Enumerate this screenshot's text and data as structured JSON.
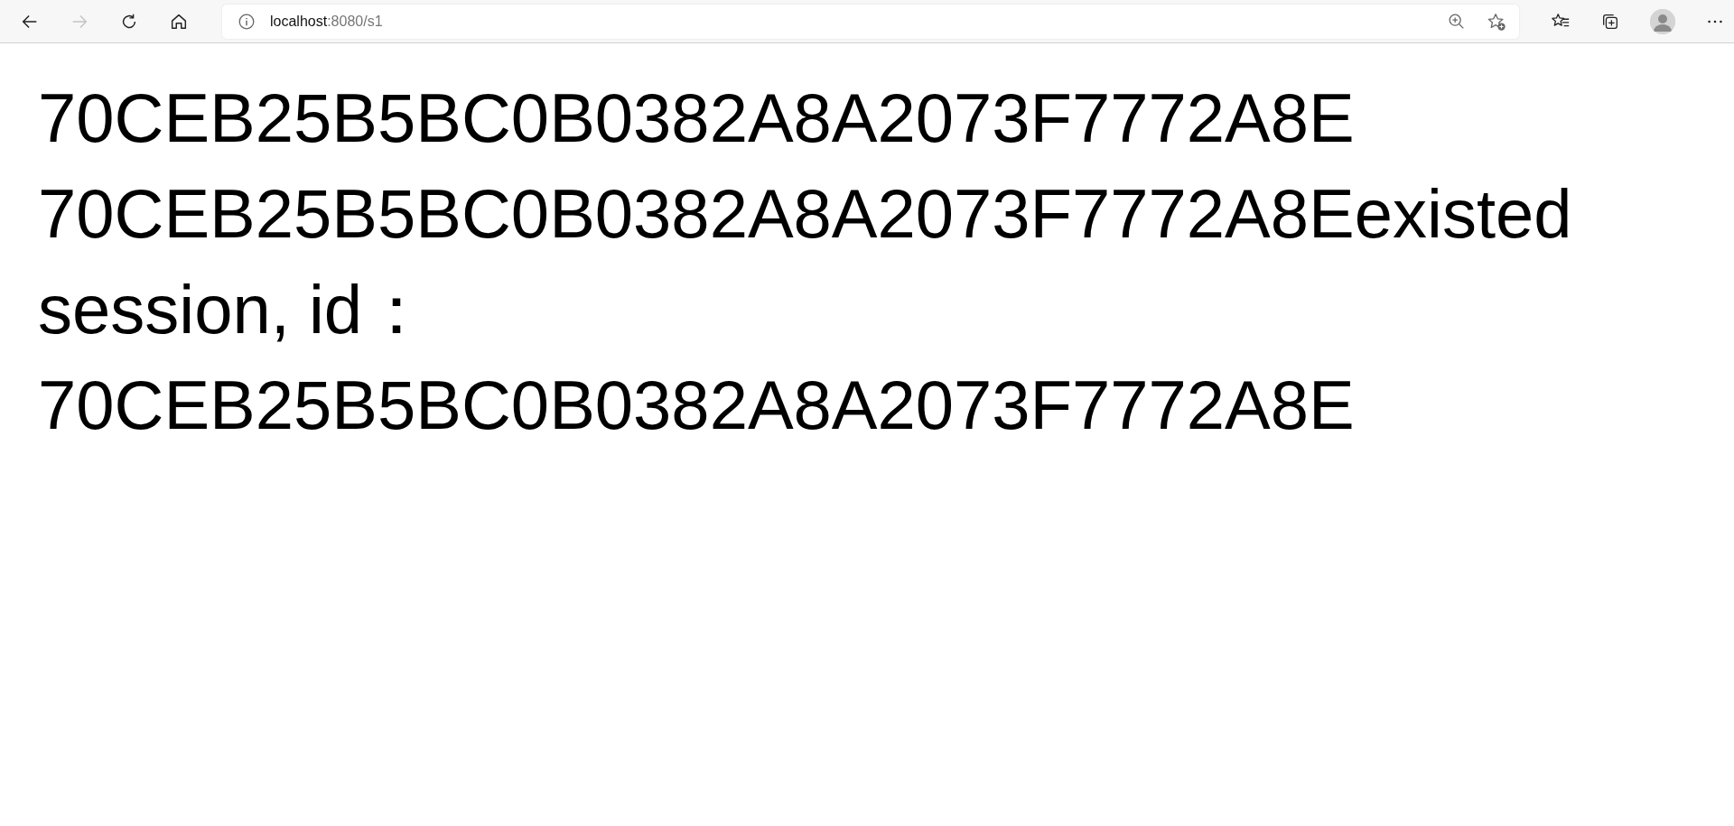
{
  "browser": {
    "back_disabled": false,
    "forward_disabled": true,
    "address": {
      "host": "localhost",
      "path": ":8080/s1"
    }
  },
  "page": {
    "lines": [
      "70CEB25B5BC0B0382A8A2073F7772A8E",
      "70CEB25B5BC0B0382A8A2073F7772A8Eexisted session, id：70CEB25B5BC0B0382A8A2073F7772A8E"
    ]
  }
}
